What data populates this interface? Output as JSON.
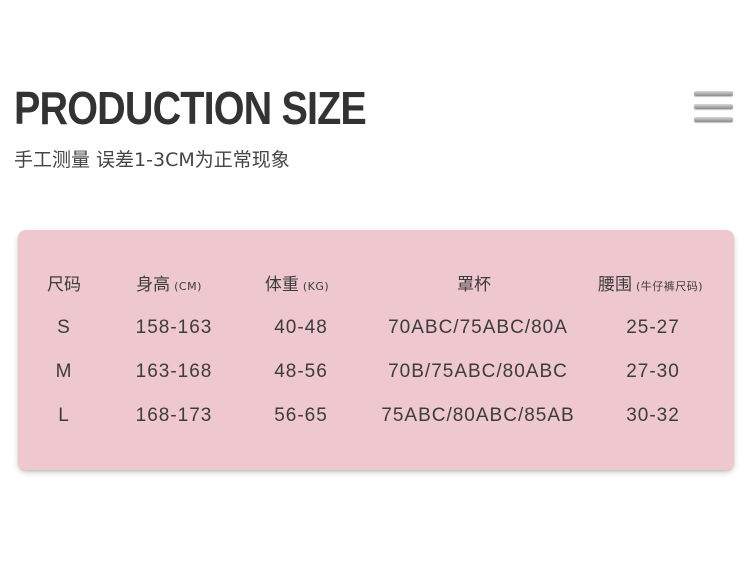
{
  "header": {
    "title": "PRODUCTION SIZE",
    "subtitle": "手工测量  误差1-3CM为正常现象"
  },
  "size_table": {
    "columns": [
      {
        "label": "尺码",
        "unit": ""
      },
      {
        "label": "身高",
        "unit": "(CM)"
      },
      {
        "label": "体重",
        "unit": "(KG)"
      },
      {
        "label": "罩杯",
        "unit": ""
      },
      {
        "label": "腰围",
        "unit": "(牛仔裤尺码)"
      }
    ],
    "rows": [
      [
        "S",
        "158-163",
        "40-48",
        "70ABC/75ABC/80A",
        "25-27"
      ],
      [
        "M",
        "163-168",
        "48-56",
        "70B/75ABC/80ABC",
        "27-30"
      ],
      [
        "L",
        "168-173",
        "56-65",
        "75ABC/80ABC/85AB",
        "30-32"
      ]
    ]
  },
  "colors": {
    "card_background": "#efc7cf",
    "text": "#3c3c3c"
  },
  "icons": {
    "menu": "hamburger-menu-icon"
  }
}
